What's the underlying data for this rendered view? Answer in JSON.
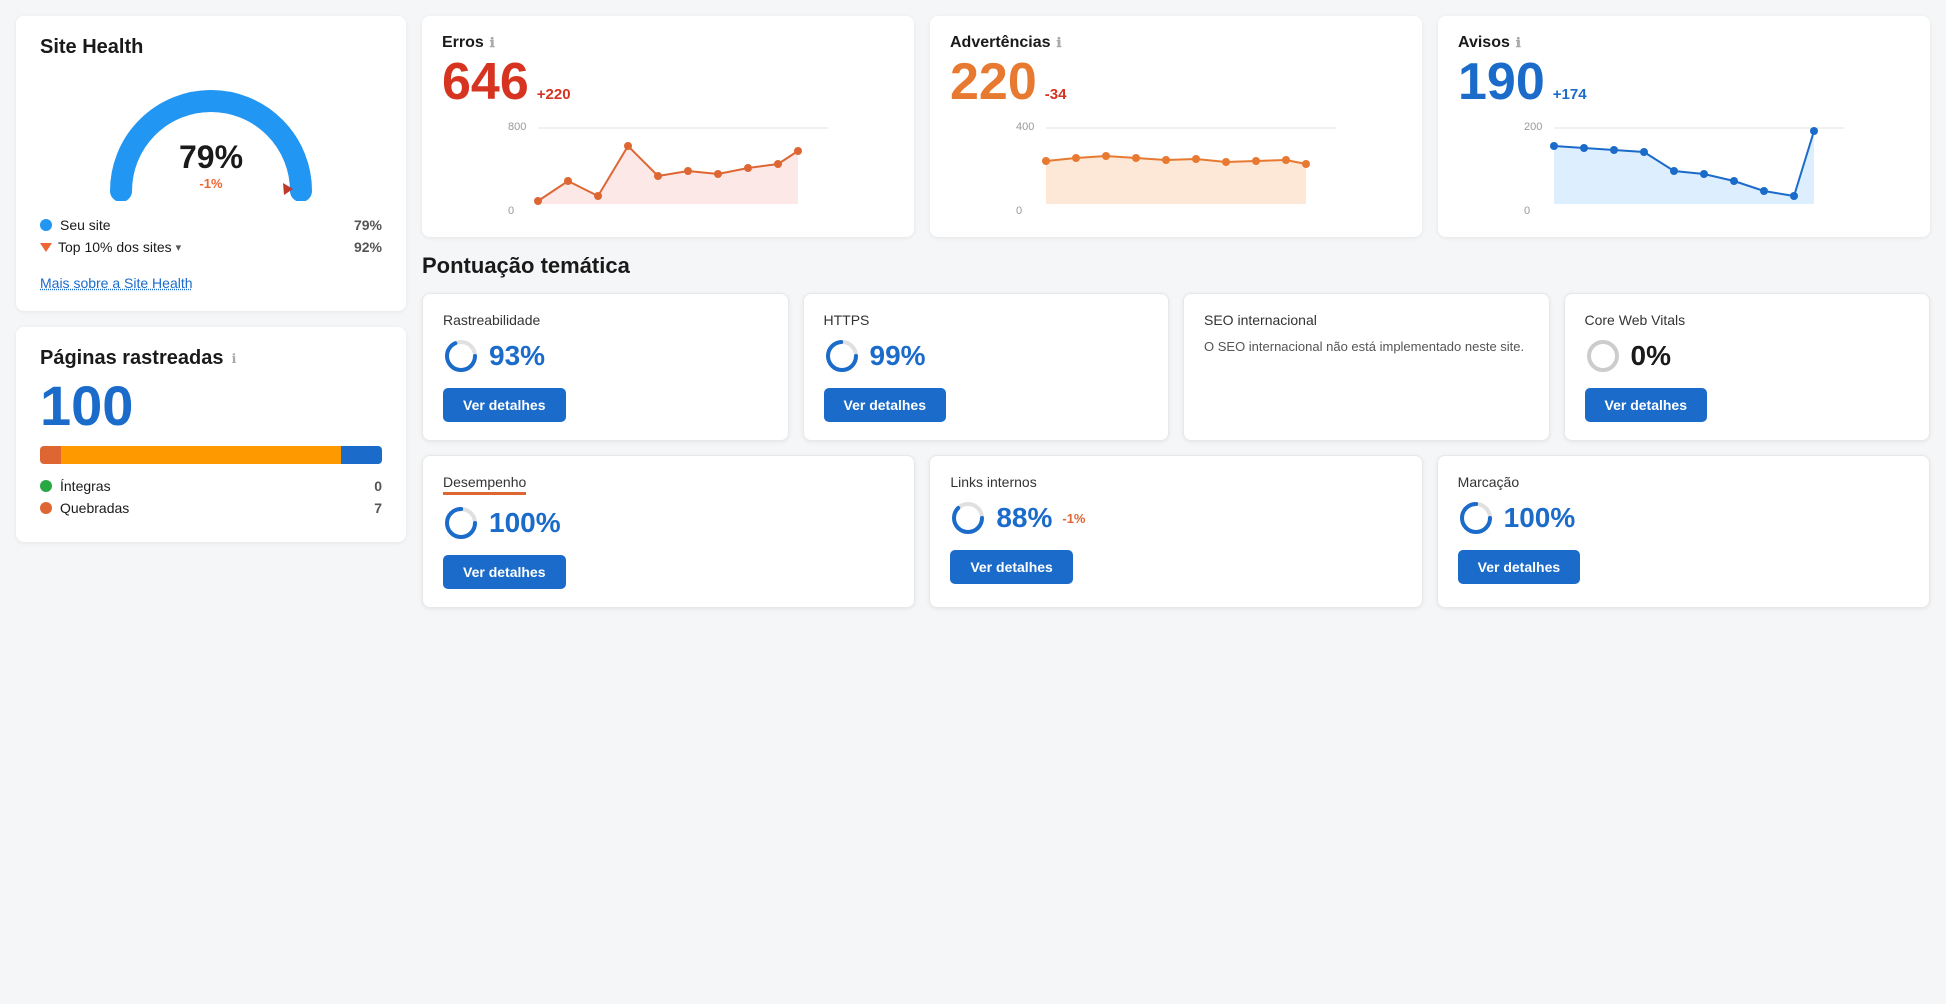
{
  "siteHealth": {
    "title": "Site Health",
    "percent": "79%",
    "delta": "-1%",
    "legend": [
      {
        "label": "Seu site",
        "value": "79%",
        "color": "#2196f3",
        "type": "dot"
      },
      {
        "label": "Top 10% dos sites",
        "value": "92%",
        "color": "#e63",
        "type": "triangle"
      }
    ],
    "moreLink": "Mais sobre a Site Health"
  },
  "paginasRastreadas": {
    "title": "Páginas rastreadas",
    "count": "100",
    "legendItems": [
      {
        "label": "Íntegras",
        "value": "0",
        "color": "#28a745"
      },
      {
        "label": "Quebradas",
        "value": "7",
        "color": "#d63"
      }
    ]
  },
  "metrics": [
    {
      "title": "Erros",
      "value": "646",
      "delta": "+220",
      "deltaType": "red",
      "colorClass": "metric-big-red",
      "chartColor": "#d63",
      "chartFill": "#fde8e8",
      "yMax": "800",
      "yMin": "0"
    },
    {
      "title": "Advertências",
      "value": "220",
      "delta": "-34",
      "deltaType": "red",
      "colorClass": "metric-big-orange",
      "chartColor": "#e87930",
      "chartFill": "#fde8d8",
      "yMax": "400",
      "yMin": "0"
    },
    {
      "title": "Avisos",
      "value": "190",
      "delta": "+174",
      "deltaType": "blue",
      "colorClass": "metric-big-blue",
      "chartColor": "#1a6bca",
      "chartFill": "#ddeeff",
      "yMax": "200",
      "yMin": "0"
    }
  ],
  "pontuacao": {
    "title": "Pontuação temática",
    "topRow": [
      {
        "title": "Rastreabilidade",
        "percent": "93%",
        "ringColor": "#1a6bca",
        "ringPct": 93,
        "btnLabel": "Ver detalhes",
        "note": null
      },
      {
        "title": "HTTPS",
        "percent": "99%",
        "ringColor": "#1a6bca",
        "ringPct": 99,
        "btnLabel": "Ver detalhes",
        "note": null
      },
      {
        "title": "SEO internacional",
        "percent": null,
        "ringColor": "#1a6bca",
        "ringPct": 0,
        "btnLabel": null,
        "note": "O SEO internacional não está implementado neste site."
      },
      {
        "title": "Core Web Vitals",
        "percent": "0%",
        "ringColor": "#bbb",
        "ringPct": 0,
        "btnLabel": "Ver detalhes",
        "note": null
      }
    ],
    "bottomRow": [
      {
        "title": "Desempenho",
        "percent": "100%",
        "ringColor": "#1a6bca",
        "ringPct": 100,
        "btnLabel": "Ver detalhes",
        "underline": true,
        "delta": null
      },
      {
        "title": "Links internos",
        "percent": "88%",
        "ringColor": "#1a6bca",
        "ringPct": 88,
        "btnLabel": "Ver detalhes",
        "underline": false,
        "delta": "-1%"
      },
      {
        "title": "Marcação",
        "percent": "100%",
        "ringColor": "#1a6bca",
        "ringPct": 100,
        "btnLabel": "Ver detalhes",
        "underline": false,
        "delta": null
      }
    ]
  }
}
